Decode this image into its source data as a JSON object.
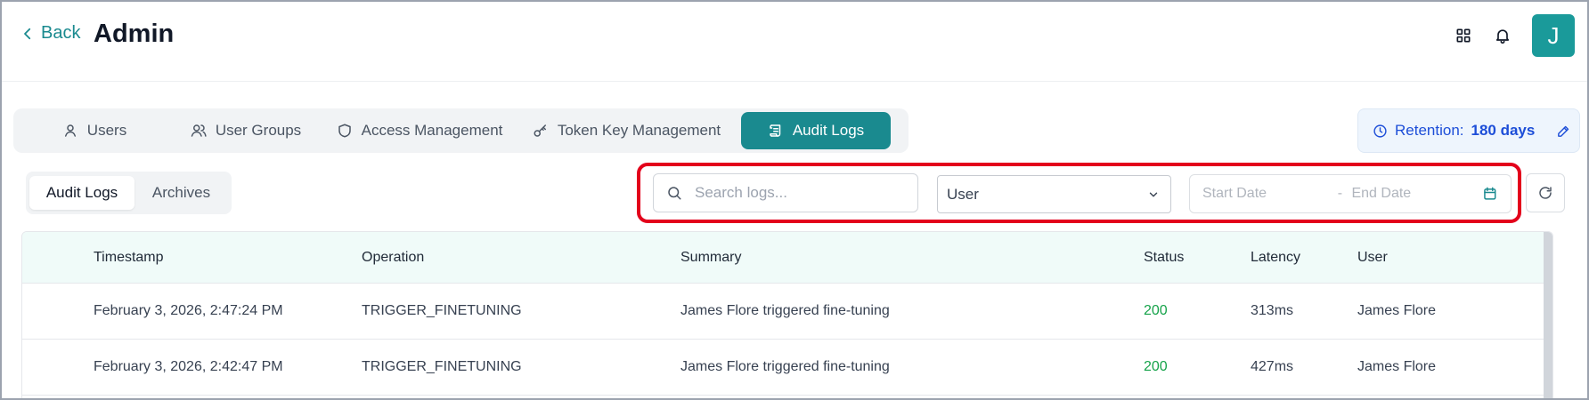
{
  "header": {
    "back_label": "Back",
    "title": "Admin",
    "avatar_initial": "J"
  },
  "tabs": [
    {
      "label": "Users",
      "icon": "user-icon",
      "active": false
    },
    {
      "label": "User Groups",
      "icon": "users-icon",
      "active": false
    },
    {
      "label": "Access Management",
      "icon": "shield-icon",
      "active": false
    },
    {
      "label": "Token Key Management",
      "icon": "key-icon",
      "active": false
    },
    {
      "label": "Audit Logs",
      "icon": "scroll-icon",
      "active": true
    }
  ],
  "retention": {
    "label": "Retention:",
    "value": "180 days"
  },
  "subtabs": [
    {
      "label": "Audit Logs",
      "active": true
    },
    {
      "label": "Archives",
      "active": false
    }
  ],
  "filters": {
    "search_placeholder": "Search logs...",
    "search_value": "",
    "select_value": "User",
    "start_placeholder": "Start Date",
    "separator": "-",
    "end_placeholder": "End Date"
  },
  "table": {
    "columns": [
      "Timestamp",
      "Operation",
      "Summary",
      "Status",
      "Latency",
      "User"
    ],
    "rows": [
      {
        "timestamp": "February 3, 2026, 2:47:24 PM",
        "operation": "TRIGGER_FINETUNING",
        "summary": "James Flore triggered fine-tuning",
        "status": "200",
        "latency": "313ms",
        "user": "James Flore"
      },
      {
        "timestamp": "February 3, 2026, 2:42:47 PM",
        "operation": "TRIGGER_FINETUNING",
        "summary": "James Flore triggered fine-tuning",
        "status": "200",
        "latency": "427ms",
        "user": "James Flore"
      }
    ]
  },
  "colors": {
    "accent": "#1a8a8f",
    "status_ok": "#16a34a",
    "highlight": "#e3001b",
    "retention_text": "#1d4ed8"
  }
}
